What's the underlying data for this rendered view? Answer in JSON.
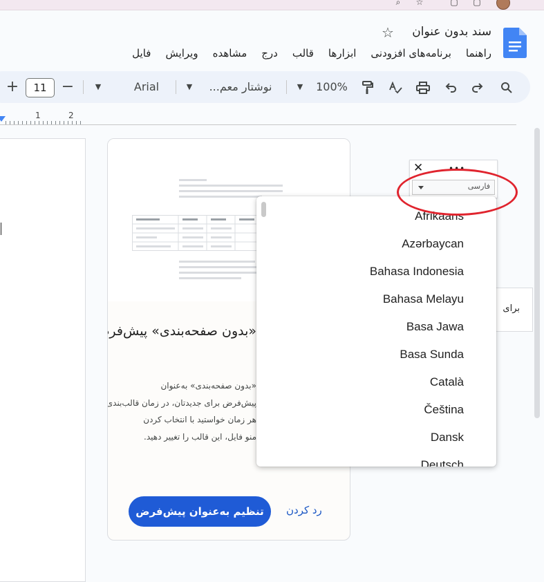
{
  "document": {
    "title": "سند بدون عنوان",
    "menu": [
      "فایل",
      "ویرایش",
      "مشاهده",
      "درج",
      "قالب",
      "ابزارها",
      "برنامه‌های افزودنی",
      "راهنما"
    ]
  },
  "toolbar": {
    "zoom": "100%",
    "style": "نوشتار معم...",
    "font": "Arial",
    "font_size": "11",
    "minus": "−",
    "plus": "+"
  },
  "ruler": {
    "numbers": [
      "1",
      "2"
    ]
  },
  "template_card": {
    "title": "«بدون صفحه‌بندی» پیش‌فرض",
    "description_lines": [
      "«بدون صفحه‌بندی» به‌عنوان",
      "پیش‌فرض برای جدیدتان، در زمان قالب‌بندی",
      "هر زمان خواستید با انتخاب کردن",
      "منو فایل، این قالب را تغییر دهید."
    ],
    "set_default_label": "تنظیم به‌عنوان پیش‌فرض",
    "dismiss_label": "رد کردن"
  },
  "language_widget": {
    "close": "✕",
    "more": "•••",
    "selected": "فارسی"
  },
  "side_box": {
    "text": "برای"
  },
  "language_dropdown": {
    "options": [
      "Afrikaans",
      "Azərbaycan",
      "Bahasa Indonesia",
      "Bahasa Melayu",
      "Basa Jawa",
      "Basa Sunda",
      "Català",
      "Čeština",
      "Dansk",
      "Deutsch"
    ]
  },
  "colors": {
    "accent": "#1f5bd6",
    "annotation": "#e0242e",
    "toolbar_bg": "#edf2fa"
  }
}
